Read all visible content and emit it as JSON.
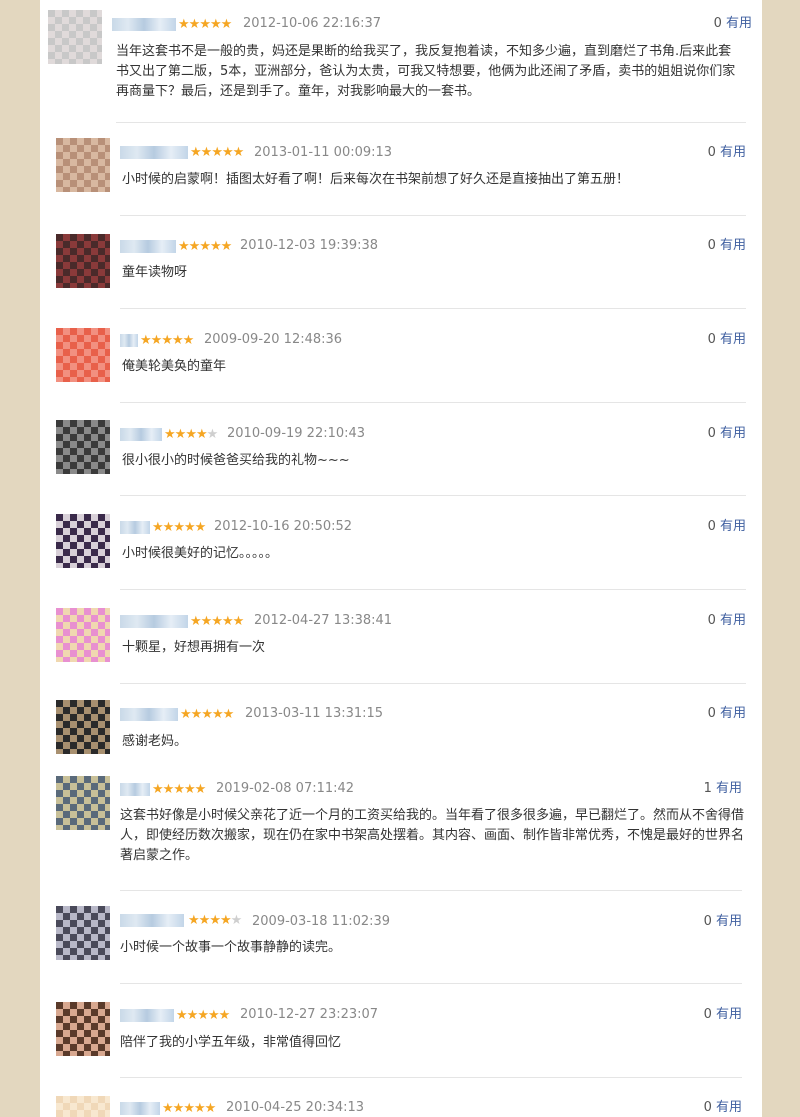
{
  "useful_label": "有用",
  "reviews": [
    {
      "date": "2012-10-06 22:16:37",
      "stars": 5,
      "useful": "0",
      "comment": "当年这套书不是一般的贵，妈还是果断的给我买了，我反复抱着读，不知多少遍，直到磨烂了书角.后来此套书又出了第二版，5本，亚洲部分，爸认为太贵，可我又特想要，他俩为此还闹了矛盾，卖书的姐姐说你们家再商量下？最后，还是到手了。童年，对我影响最大的一套书。",
      "avatar": [
        "#c8c8c8",
        "#e0dada"
      ]
    },
    {
      "date": "2013-01-11 00:09:13",
      "stars": 5,
      "useful": "0",
      "comment": "小时候的启蒙啊！插图太好看了啊！后来每次在书架前想了好久还是直接抽出了第五册！",
      "avatar": [
        "#b89078",
        "#d8b8a0"
      ]
    },
    {
      "date": "2010-12-03 19:39:38",
      "stars": 5,
      "useful": "0",
      "comment": "童年读物呀",
      "avatar": [
        "#4a2a2a",
        "#8a3a3a"
      ]
    },
    {
      "date": "2009-09-20 12:48:36",
      "stars": 5,
      "useful": "0",
      "comment": "俺美轮美奂的童年",
      "avatar": [
        "#e8604a",
        "#f29080"
      ]
    },
    {
      "date": "2010-09-19 22:10:43",
      "stars": 4,
      "useful": "0",
      "comment": "很小很小的时候爸爸买给我的礼物~~~",
      "avatar": [
        "#3a3a3a",
        "#8a8a8a"
      ]
    },
    {
      "date": "2012-10-16 20:50:52",
      "stars": 5,
      "useful": "0",
      "comment": "小时候很美好的记忆。。。。。",
      "avatar": [
        "#3a2a4a",
        "#d8d0d8"
      ]
    },
    {
      "date": "2012-04-27 13:38:41",
      "stars": 5,
      "useful": "0",
      "comment": "十颗星，好想再拥有一次",
      "avatar": [
        "#e890d0",
        "#f0d8b0"
      ]
    },
    {
      "date": "2013-03-11 13:31:15",
      "stars": 5,
      "useful": "0",
      "comment": "感谢老妈。",
      "avatar": [
        "#2a2a2a",
        "#a89070"
      ]
    },
    {
      "date": "2019-02-08 07:11:42",
      "stars": 5,
      "useful": "1",
      "comment": "这套书好像是小时候父亲花了近一个月的工资买给我的。当年看了很多很多遍，早已翻烂了。然而从不舍得借人，即使经历数次搬家，现在仍在家中书架高处摆着。其内容、画面、制作皆非常优秀，不愧是最好的世界名著启蒙之作。",
      "avatar": [
        "#5a6a7a",
        "#c8c098"
      ]
    },
    {
      "date": "2009-03-18 11:02:39",
      "stars": 4,
      "useful": "0",
      "comment": "小时候一个故事一个故事静静的读完。",
      "avatar": [
        "#4a4a5a",
        "#b8b8c8"
      ]
    },
    {
      "date": "2010-12-27 23:23:07",
      "stars": 5,
      "useful": "0",
      "comment": "陪伴了我的小学五年级，非常值得回忆",
      "avatar": [
        "#5a3a2a",
        "#d8a890"
      ]
    },
    {
      "date": "2010-04-25 20:34:13",
      "stars": 5,
      "useful": "0",
      "comment": "",
      "avatar": [
        "#f0d8b8",
        "#f8e8d0"
      ]
    }
  ]
}
